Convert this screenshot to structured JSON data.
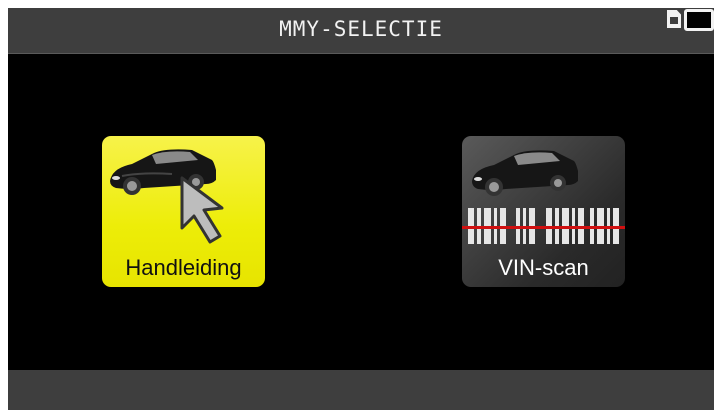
{
  "header": {
    "title": "MMY-SELECTIE"
  },
  "status": {
    "sd_icon": "sd-card-icon",
    "battery_icon": "battery-icon"
  },
  "options": [
    {
      "label": "Handleiding",
      "icon": "car-cursor-icon",
      "selected": true,
      "color": "#eeea10"
    },
    {
      "label": "VIN-scan",
      "icon": "car-barcode-icon",
      "selected": false,
      "color": "#3a3a3a"
    }
  ],
  "colors": {
    "bar": "#3e3e3e",
    "background": "#000000"
  }
}
